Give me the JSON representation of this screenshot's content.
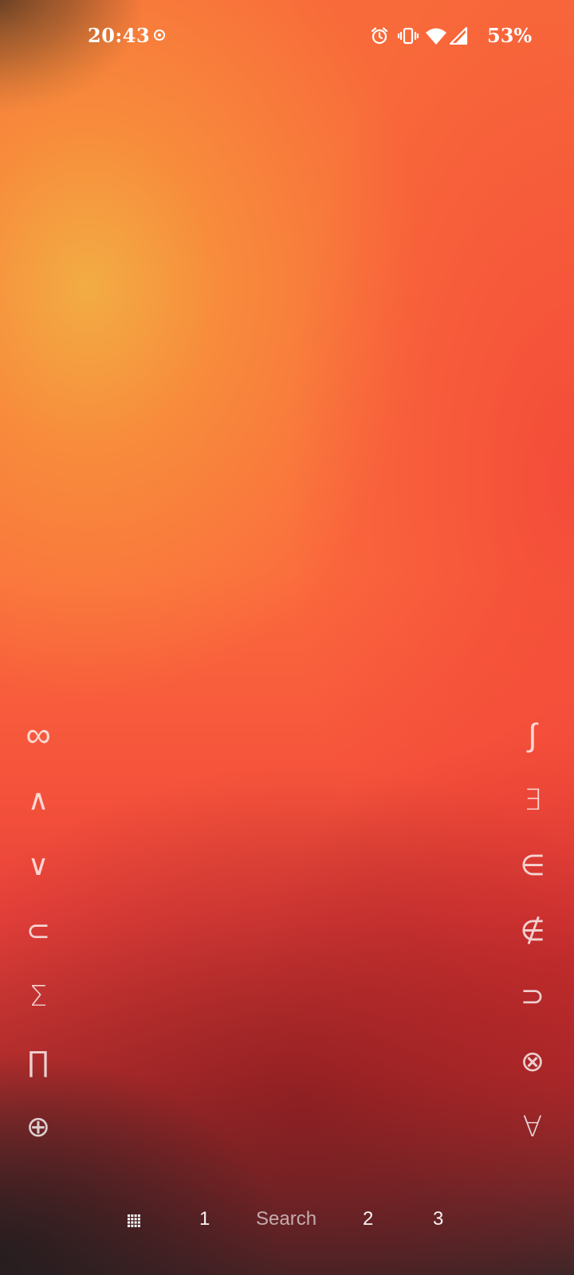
{
  "status_bar": {
    "time": "20:43",
    "record_icon": "screen-record-icon",
    "alarm_icon": "alarm-icon",
    "vibrate_icon": "vibrate-icon",
    "wifi_icon": "wifi-icon",
    "signal_icon": "cell-signal-icon",
    "battery_percent": "53%"
  },
  "symbols_left": [
    "∞",
    "∧",
    "∨",
    "⊂",
    "Σ",
    "∏",
    "⊕"
  ],
  "symbols_right": [
    "∫",
    "∃",
    "∈",
    "∉",
    "⊃",
    "⊗",
    "∀"
  ],
  "dock": {
    "grid_icon": "app-grid-icon",
    "page_1": "1",
    "search_label": "Search",
    "page_2": "2",
    "page_3": "3"
  },
  "colors": {
    "wallpaper_top": "#f86a3a",
    "wallpaper_glow": "#f2b044",
    "wallpaper_bottom": "#3a2729",
    "symbol_color": "#ffffff"
  }
}
